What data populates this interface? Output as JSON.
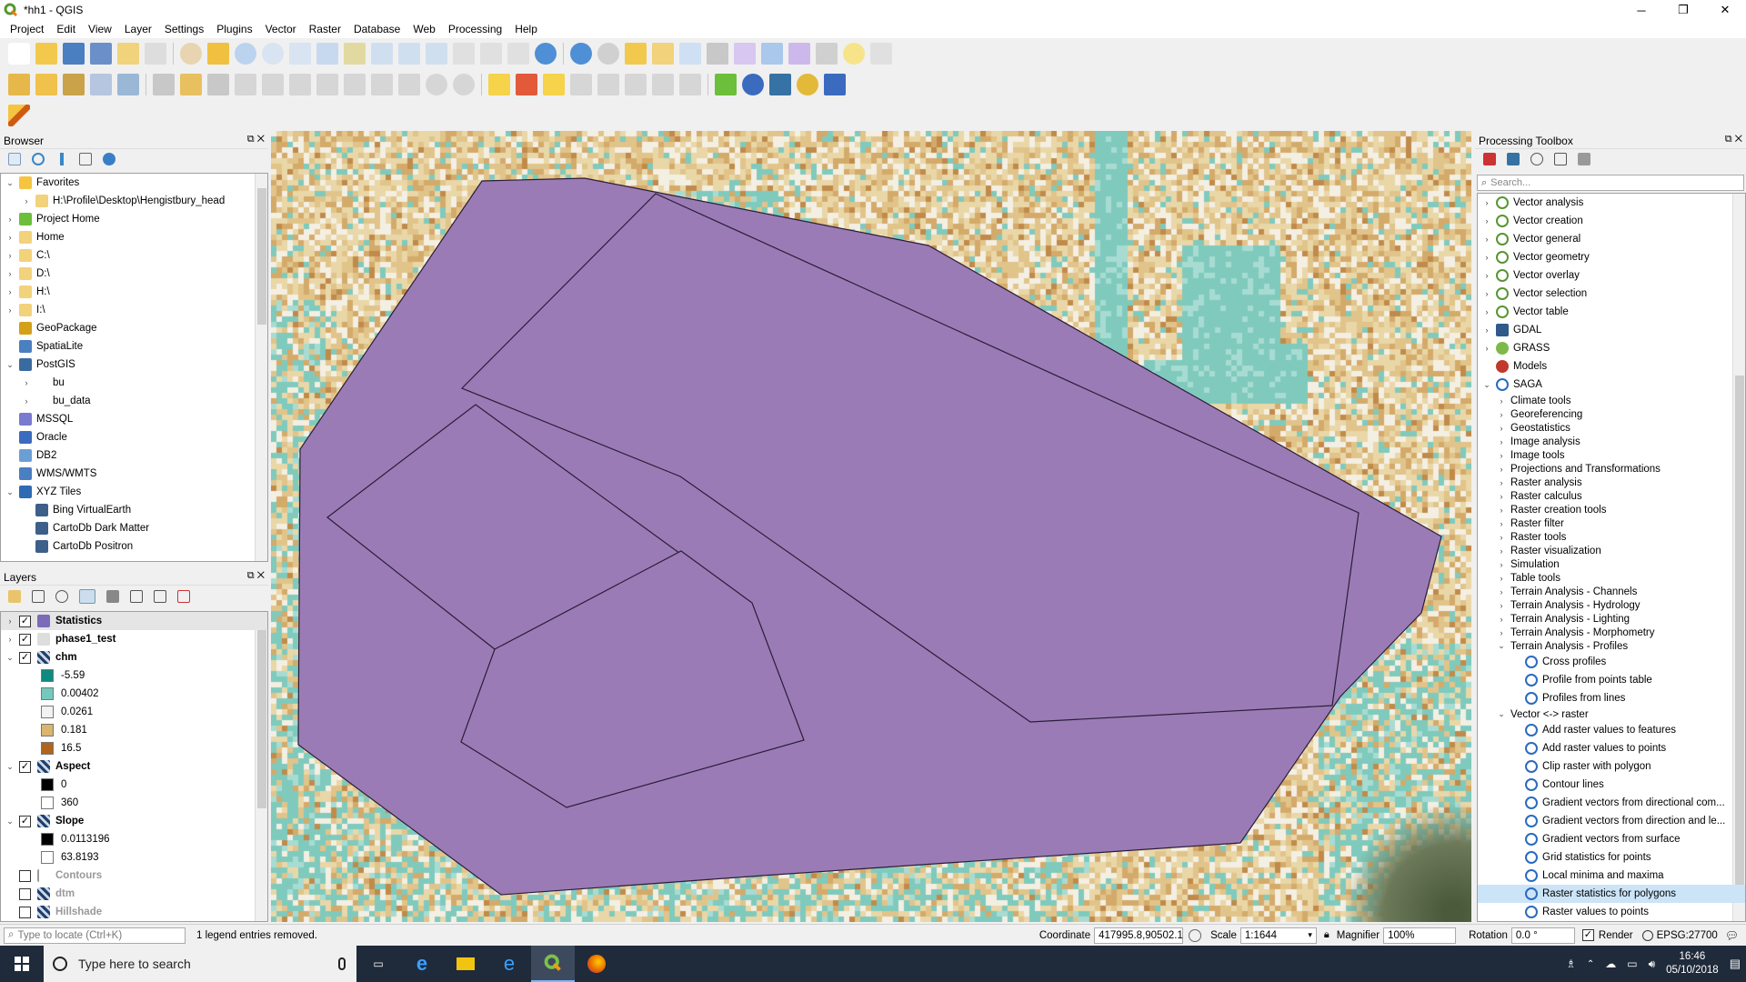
{
  "window": {
    "title": "*hh1 - QGIS",
    "minimize": "─",
    "maximize": "❐",
    "close": "✕"
  },
  "menu": [
    "Project",
    "Edit",
    "View",
    "Layer",
    "Settings",
    "Plugins",
    "Vector",
    "Raster",
    "Database",
    "Web",
    "Processing",
    "Help"
  ],
  "browser": {
    "title": "Browser",
    "items": [
      {
        "label": "Favorites",
        "arrow": "⌄",
        "indent": 0
      },
      {
        "label": "H:\\Profile\\Desktop\\Hengistbury_head",
        "arrow": "›",
        "indent": 1
      },
      {
        "label": "Project Home",
        "arrow": "›",
        "indent": 0
      },
      {
        "label": "Home",
        "arrow": "›",
        "indent": 0
      },
      {
        "label": "C:\\",
        "arrow": "›",
        "indent": 0
      },
      {
        "label": "D:\\",
        "arrow": "›",
        "indent": 0
      },
      {
        "label": "H:\\",
        "arrow": "›",
        "indent": 0
      },
      {
        "label": "I:\\",
        "arrow": "›",
        "indent": 0
      },
      {
        "label": "GeoPackage",
        "arrow": "",
        "indent": 0
      },
      {
        "label": "SpatiaLite",
        "arrow": "",
        "indent": 0
      },
      {
        "label": "PostGIS",
        "arrow": "⌄",
        "indent": 0
      },
      {
        "label": "bu",
        "arrow": "›",
        "indent": 1
      },
      {
        "label": "bu_data",
        "arrow": "›",
        "indent": 1
      },
      {
        "label": "MSSQL",
        "arrow": "",
        "indent": 0
      },
      {
        "label": "Oracle",
        "arrow": "",
        "indent": 0
      },
      {
        "label": "DB2",
        "arrow": "",
        "indent": 0
      },
      {
        "label": "WMS/WMTS",
        "arrow": "",
        "indent": 0
      },
      {
        "label": "XYZ Tiles",
        "arrow": "⌄",
        "indent": 0
      },
      {
        "label": "Bing VirtualEarth",
        "arrow": "",
        "indent": 1
      },
      {
        "label": "CartoDb Dark Matter",
        "arrow": "",
        "indent": 1
      },
      {
        "label": "CartoDb Positron",
        "arrow": "",
        "indent": 1
      }
    ]
  },
  "layers": {
    "title": "Layers",
    "items": [
      {
        "label": "Statistics",
        "type": "layer",
        "checked": true,
        "arrow": "›",
        "bold": true,
        "selected": true,
        "color": "#7b6bb8"
      },
      {
        "label": "phase1_test",
        "type": "layer",
        "checked": true,
        "arrow": "›",
        "bold": true
      },
      {
        "label": "chm",
        "type": "layer",
        "checked": true,
        "arrow": "⌄",
        "bold": true
      },
      {
        "label": "-5.59",
        "type": "legend",
        "color": "#0f8a80"
      },
      {
        "label": "0.00402",
        "type": "legend",
        "color": "#74c9bd"
      },
      {
        "label": "0.0261",
        "type": "legend",
        "color": "#f2f2f0"
      },
      {
        "label": "0.181",
        "type": "legend",
        "color": "#d9b570"
      },
      {
        "label": "16.5",
        "type": "legend",
        "color": "#b0651d"
      },
      {
        "label": "Aspect",
        "type": "layer",
        "checked": true,
        "arrow": "⌄",
        "bold": true
      },
      {
        "label": "0",
        "type": "legend",
        "color": "#000000"
      },
      {
        "label": "360",
        "type": "legend",
        "color": "#ffffff"
      },
      {
        "label": "Slope",
        "type": "layer",
        "checked": true,
        "arrow": "⌄",
        "bold": true
      },
      {
        "label": "0.0113196",
        "type": "legend",
        "color": "#000000"
      },
      {
        "label": "63.8193",
        "type": "legend",
        "color": "#ffffff"
      },
      {
        "label": "Contours",
        "type": "layer",
        "checked": false,
        "arrow": "",
        "bold": true,
        "dim": true
      },
      {
        "label": "dtm",
        "type": "layer",
        "checked": false,
        "arrow": "",
        "bold": true,
        "dim": true
      },
      {
        "label": "Hillshade",
        "type": "layer",
        "checked": false,
        "arrow": "",
        "bold": true,
        "dim": true
      }
    ]
  },
  "toolbox": {
    "title": "Processing Toolbox",
    "search_placeholder": "Search...",
    "items": [
      {
        "label": "Vector analysis",
        "level": 0,
        "arrow": "›",
        "icon": "q"
      },
      {
        "label": "Vector creation",
        "level": 0,
        "arrow": "›",
        "icon": "q"
      },
      {
        "label": "Vector general",
        "level": 0,
        "arrow": "›",
        "icon": "q"
      },
      {
        "label": "Vector geometry",
        "level": 0,
        "arrow": "›",
        "icon": "q"
      },
      {
        "label": "Vector overlay",
        "level": 0,
        "arrow": "›",
        "icon": "q"
      },
      {
        "label": "Vector selection",
        "level": 0,
        "arrow": "›",
        "icon": "q"
      },
      {
        "label": "Vector table",
        "level": 0,
        "arrow": "›",
        "icon": "q"
      },
      {
        "label": "GDAL",
        "level": 0,
        "arrow": "›",
        "icon": "gdal"
      },
      {
        "label": "GRASS",
        "level": 0,
        "arrow": "›",
        "icon": "grass"
      },
      {
        "label": "Models",
        "level": 0,
        "arrow": "",
        "icon": "models"
      },
      {
        "label": "SAGA",
        "level": 0,
        "arrow": "⌄",
        "icon": "saga"
      },
      {
        "label": "Climate tools",
        "level": 1,
        "arrow": "›"
      },
      {
        "label": "Georeferencing",
        "level": 1,
        "arrow": "›"
      },
      {
        "label": "Geostatistics",
        "level": 1,
        "arrow": "›"
      },
      {
        "label": "Image analysis",
        "level": 1,
        "arrow": "›"
      },
      {
        "label": "Image tools",
        "level": 1,
        "arrow": "›"
      },
      {
        "label": "Projections and Transformations",
        "level": 1,
        "arrow": "›"
      },
      {
        "label": "Raster analysis",
        "level": 1,
        "arrow": "›"
      },
      {
        "label": "Raster calculus",
        "level": 1,
        "arrow": "›"
      },
      {
        "label": "Raster creation tools",
        "level": 1,
        "arrow": "›"
      },
      {
        "label": "Raster filter",
        "level": 1,
        "arrow": "›"
      },
      {
        "label": "Raster tools",
        "level": 1,
        "arrow": "›"
      },
      {
        "label": "Raster visualization",
        "level": 1,
        "arrow": "›"
      },
      {
        "label": "Simulation",
        "level": 1,
        "arrow": "›"
      },
      {
        "label": "Table tools",
        "level": 1,
        "arrow": "›"
      },
      {
        "label": "Terrain Analysis - Channels",
        "level": 1,
        "arrow": "›"
      },
      {
        "label": "Terrain Analysis - Hydrology",
        "level": 1,
        "arrow": "›"
      },
      {
        "label": "Terrain Analysis - Lighting",
        "level": 1,
        "arrow": "›"
      },
      {
        "label": "Terrain Analysis - Morphometry",
        "level": 1,
        "arrow": "›"
      },
      {
        "label": "Terrain Analysis - Profiles",
        "level": 1,
        "arrow": "⌄"
      },
      {
        "label": "Cross profiles",
        "level": 2,
        "arrow": "",
        "icon": "saga"
      },
      {
        "label": "Profile from points table",
        "level": 2,
        "arrow": "",
        "icon": "saga"
      },
      {
        "label": "Profiles from lines",
        "level": 2,
        "arrow": "",
        "icon": "saga"
      },
      {
        "label": "Vector <-> raster",
        "level": 1,
        "arrow": "⌄"
      },
      {
        "label": "Add raster values to features",
        "level": 2,
        "arrow": "",
        "icon": "saga"
      },
      {
        "label": "Add raster values to points",
        "level": 2,
        "arrow": "",
        "icon": "saga"
      },
      {
        "label": "Clip raster with polygon",
        "level": 2,
        "arrow": "",
        "icon": "saga"
      },
      {
        "label": "Contour lines",
        "level": 2,
        "arrow": "",
        "icon": "saga"
      },
      {
        "label": "Gradient vectors from directional com...",
        "level": 2,
        "arrow": "",
        "icon": "saga"
      },
      {
        "label": "Gradient vectors from direction and le...",
        "level": 2,
        "arrow": "",
        "icon": "saga"
      },
      {
        "label": "Gradient vectors from surface",
        "level": 2,
        "arrow": "",
        "icon": "saga"
      },
      {
        "label": "Grid statistics for points",
        "level": 2,
        "arrow": "",
        "icon": "saga"
      },
      {
        "label": "Local minima and maxima",
        "level": 2,
        "arrow": "",
        "icon": "saga"
      },
      {
        "label": "Raster statistics for polygons",
        "level": 2,
        "arrow": "",
        "icon": "saga",
        "selected": true
      },
      {
        "label": "Raster values to points",
        "level": 2,
        "arrow": "",
        "icon": "saga"
      }
    ]
  },
  "status": {
    "locate_placeholder": "Type to locate (Ctrl+K)",
    "message": "1 legend entries removed.",
    "coordinate_label": "Coordinate",
    "coordinate": "417995.8,90502.1",
    "scale_label": "Scale",
    "scale": "1:1644",
    "magnifier_label": "Magnifier",
    "magnifier": "100%",
    "rotation_label": "Rotation",
    "rotation": "0.0 °",
    "render_label": "Render",
    "crs": "EPSG:27700"
  },
  "taskbar": {
    "search_placeholder": "Type here to search",
    "time": "16:46",
    "date": "05/10/2018"
  },
  "colors": {
    "polygon_fill": "#9b7bb5",
    "teal": "#7fcabd",
    "sand": "#e3c792"
  }
}
